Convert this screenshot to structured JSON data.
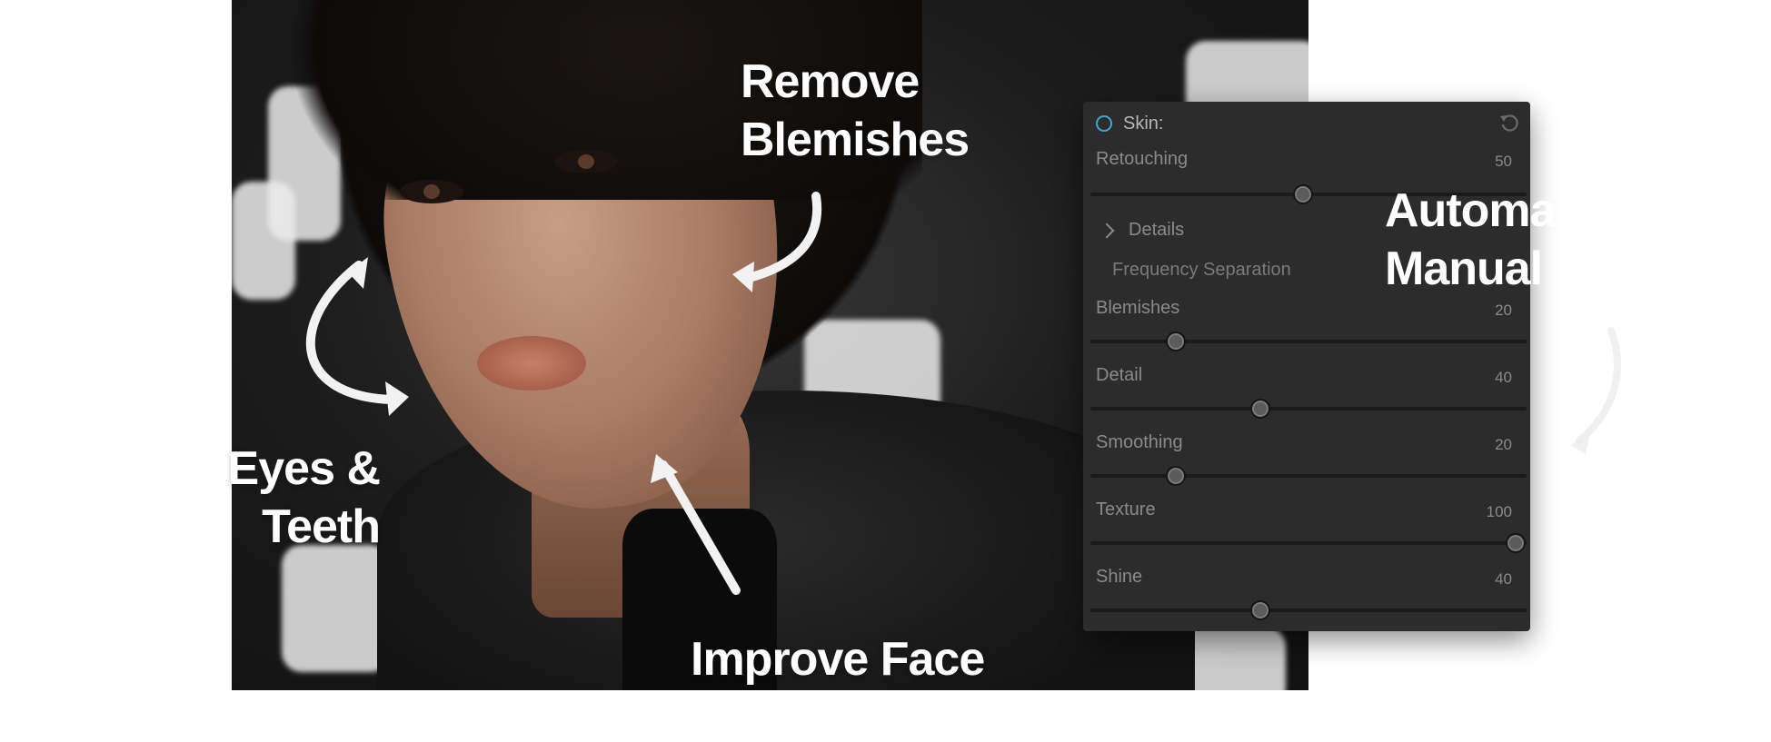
{
  "labels": {
    "remove_blemishes": [
      "Remove",
      "Blemishes"
    ],
    "eyes_teeth": [
      "Eyes &",
      "Teeth"
    ],
    "improve_face": "Improve Face",
    "automatic_manual": [
      "Automa",
      "Manual"
    ]
  },
  "panel": {
    "title": "Skin:",
    "retouching": {
      "label": "Retouching",
      "value": "50",
      "level": 0.5
    },
    "details_label": "Details",
    "frequency_separation": "Frequency Separation",
    "sliders": [
      {
        "label": "Blemishes",
        "value": "20",
        "level": 0.2
      },
      {
        "label": "Detail",
        "value": "40",
        "level": 0.4
      },
      {
        "label": "Smoothing",
        "value": "20",
        "level": 0.2
      },
      {
        "label": "Texture",
        "value": "100",
        "level": 1.0
      },
      {
        "label": "Shine",
        "value": "40",
        "level": 0.4
      }
    ]
  },
  "icons": {
    "toggle": "toggle-ring-icon",
    "reset": "reset-icon",
    "details": "chevron-right-icon"
  },
  "colors": {
    "accent": "#39a9d8",
    "panel_bg": "#2c2c2c",
    "label_text": "#ffffff"
  }
}
